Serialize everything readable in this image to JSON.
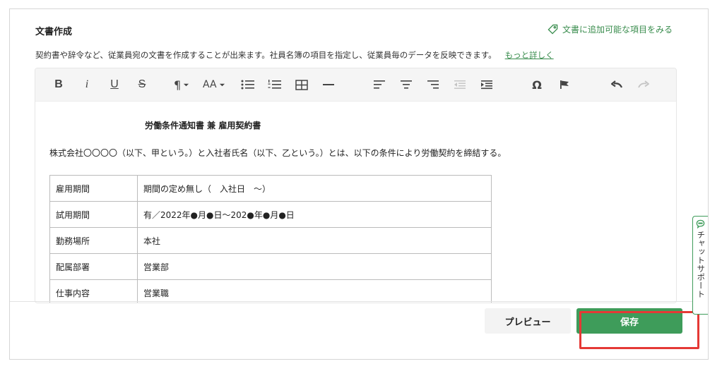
{
  "header": {
    "title": "文書作成",
    "add_items_link": "文書に追加可能な項目をみる"
  },
  "description": {
    "text": "契約書や辞令など、従業員宛の文書を作成することが出来ます。社員名簿の項目を指定し、従業員毎のデータを反映できます。",
    "more_link": "もっと詳しく"
  },
  "toolbar": {
    "bold": "B",
    "italic": "i",
    "underline": "U",
    "strike": "S",
    "paragraph": "¶",
    "font_size": "AA"
  },
  "document": {
    "title": "労働条件通知書 兼 雇用契約書",
    "intro": "株式会社〇〇〇〇（以下、甲という。）と入社者氏名（以下、乙という。）とは、以下の条件により労働契約を締結する。",
    "rows": [
      {
        "label": "雇用期間",
        "value": "期間の定め無し（　入社日　〜）"
      },
      {
        "label": "試用期間",
        "value": "有／2022年●月●日〜202●年●月●日"
      },
      {
        "label": "勤務場所",
        "value": "本社"
      },
      {
        "label": "配属部署",
        "value": "営業部"
      },
      {
        "label": "仕事内容",
        "value": "営業職"
      }
    ]
  },
  "footer": {
    "preview_label": "プレビュー",
    "save_label": "保存"
  },
  "chat": {
    "label": "チャットサポート"
  },
  "colors": {
    "accent_green": "#3e9c5a",
    "highlight_red": "#e53935"
  }
}
